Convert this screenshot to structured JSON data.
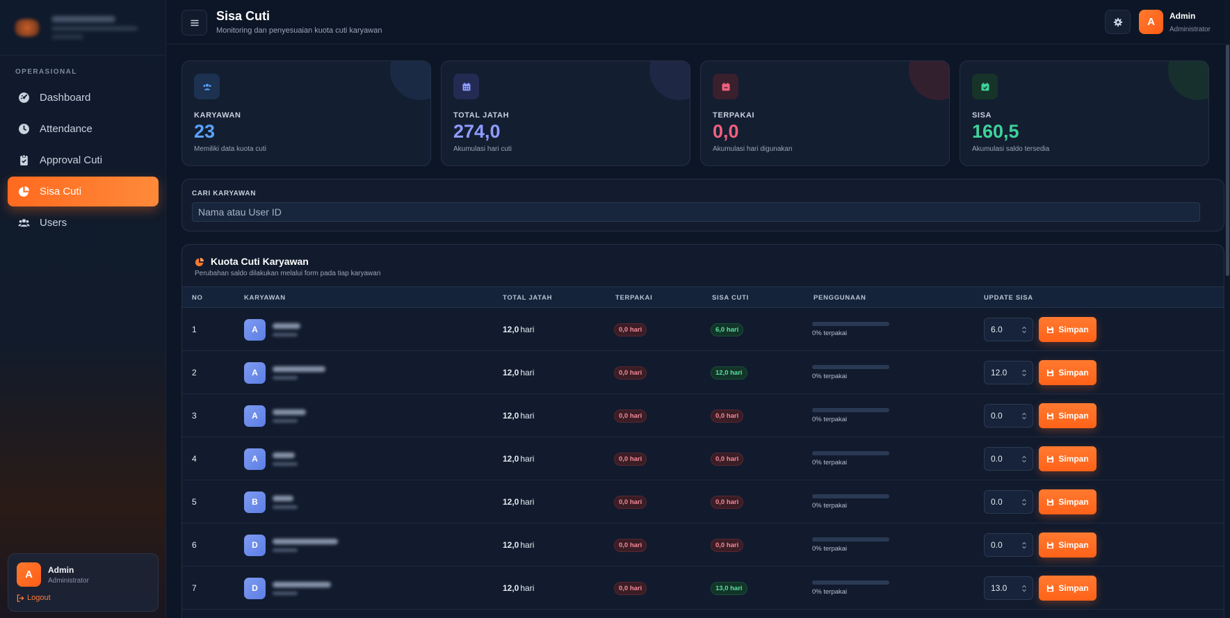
{
  "sidebar": {
    "section_label": "OPERASIONAL",
    "items": [
      {
        "label": "Dashboard",
        "icon": "dashboard-icon"
      },
      {
        "label": "Attendance",
        "icon": "clock-icon"
      },
      {
        "label": "Approval Cuti",
        "icon": "clipboard-check-icon"
      },
      {
        "label": "Sisa Cuti",
        "icon": "pie-chart-icon"
      },
      {
        "label": "Users",
        "icon": "users-icon"
      }
    ],
    "active_item": "Sisa Cuti",
    "user": {
      "initial": "A",
      "name": "Admin",
      "role": "Administrator",
      "logout": "Logout"
    }
  },
  "header": {
    "title": "Sisa Cuti",
    "subtitle": "Monitoring dan penyesuaian kuota cuti karyawan",
    "user": {
      "initial": "A",
      "name": "Admin",
      "role": "Administrator"
    }
  },
  "stats": [
    {
      "label": "KARYAWAN",
      "value": "23",
      "desc": "Memiliki data kuota cuti",
      "icon": "users-icon",
      "color": "#5aa2ff"
    },
    {
      "label": "TOTAL JATAH",
      "value": "274,0",
      "desc": "Akumulasi hari cuti",
      "icon": "calendar-icon",
      "color": "#8f9cff"
    },
    {
      "label": "TERPAKAI",
      "value": "0,0",
      "desc": "Akumulasi hari digunakan",
      "icon": "calendar-minus-icon",
      "color": "#f0607e"
    },
    {
      "label": "SISA",
      "value": "160,5",
      "desc": "Akumulasi saldo tersedia",
      "icon": "calendar-check-icon",
      "color": "#3fd29a"
    }
  ],
  "search": {
    "label": "CARI KARYAWAN",
    "placeholder": "Nama atau User ID",
    "value": ""
  },
  "table": {
    "title": "Kuota Cuti Karyawan",
    "subtitle": "Perubahan saldo dilakukan melalui form pada tiap karyawan",
    "columns": [
      "NO",
      "KARYAWAN",
      "TOTAL JATAH",
      "TERPAKAI",
      "SISA CUTI",
      "PENGGUNAAN",
      "UPDATE SISA"
    ],
    "save_label": "Simpan",
    "unit": "hari",
    "rows": [
      {
        "no": "1",
        "initial": "A",
        "total": "12,0",
        "used": "0,0 hari",
        "sisa": "6,0 hari",
        "sisa_status": "pos",
        "usage_pct": 0,
        "usage_text": "0% terpakai",
        "update": "6.0"
      },
      {
        "no": "2",
        "initial": "A",
        "total": "12,0",
        "used": "0,0 hari",
        "sisa": "12,0 hari",
        "sisa_status": "pos",
        "usage_pct": 0,
        "usage_text": "0% terpakai",
        "update": "12.0"
      },
      {
        "no": "3",
        "initial": "A",
        "total": "12,0",
        "used": "0,0 hari",
        "sisa": "0,0 hari",
        "sisa_status": "zero",
        "usage_pct": 0,
        "usage_text": "0% terpakai",
        "update": "0.0"
      },
      {
        "no": "4",
        "initial": "A",
        "total": "12,0",
        "used": "0,0 hari",
        "sisa": "0,0 hari",
        "sisa_status": "zero",
        "usage_pct": 0,
        "usage_text": "0% terpakai",
        "update": "0.0"
      },
      {
        "no": "5",
        "initial": "B",
        "total": "12,0",
        "used": "0,0 hari",
        "sisa": "0,0 hari",
        "sisa_status": "zero",
        "usage_pct": 0,
        "usage_text": "0% terpakai",
        "update": "0.0"
      },
      {
        "no": "6",
        "initial": "D",
        "total": "12,0",
        "used": "0,0 hari",
        "sisa": "0,0 hari",
        "sisa_status": "zero",
        "usage_pct": 0,
        "usage_text": "0% terpakai",
        "update": "0.0"
      },
      {
        "no": "7",
        "initial": "D",
        "total": "12,0",
        "used": "0,0 hari",
        "sisa": "13,0 hari",
        "sisa_status": "pos",
        "usage_pct": 0,
        "usage_text": "0% terpakai",
        "update": "13.0"
      }
    ]
  },
  "colors": {
    "accent": "#ff6a1f",
    "background": "#0d1626",
    "card": "#131e31"
  }
}
